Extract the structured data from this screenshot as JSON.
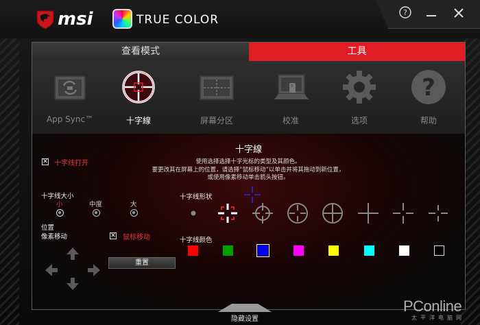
{
  "brand": {
    "logo_text": "msi",
    "product_text": "TRUE COLOR"
  },
  "window_controls": {
    "help_glyph": "?",
    "min_glyph": "—",
    "close_glyph": "✕"
  },
  "top_tabs": [
    {
      "label": "查看模式",
      "active": false
    },
    {
      "label": "工具",
      "active": true
    }
  ],
  "tools": [
    {
      "label": "App Sync™",
      "icon": "app-sync-icon",
      "active": false
    },
    {
      "label": "十字線",
      "icon": "crosshair-icon",
      "active": true
    },
    {
      "label": "屏幕分区",
      "icon": "screen-split-icon",
      "active": false
    },
    {
      "label": "校准",
      "icon": "calibration-icon",
      "active": false
    },
    {
      "label": "选项",
      "icon": "gear-icon",
      "active": false
    },
    {
      "label": "帮助",
      "icon": "help-icon",
      "active": false
    }
  ],
  "crosshair": {
    "title": "十字線",
    "description": [
      "使用选择选择十字光标的类型及其颜色。",
      "要更改其在屏幕上的位置，请选择“鼠标移动”以单击并将其拖动到新位置，",
      "或使用像素移动单击箭头按钮。"
    ],
    "enable_label": "十字线打开",
    "enable_checked": true,
    "size_label": "十字线大小",
    "sizes": [
      {
        "label": "小",
        "selected": true
      },
      {
        "label": "中度",
        "selected": false
      },
      {
        "label": "大",
        "selected": false
      }
    ],
    "position_label": "位置",
    "pixel_move_label": "像素移动",
    "mouse_move_label": "鼠标移动",
    "mouse_move_checked": true,
    "reset_label": "重置",
    "shape_label": "十字线形状",
    "shapes": [
      "dot",
      "bracket-cross",
      "scope-cross",
      "circle-cross",
      "circle-plus",
      "plus",
      "gap-plus",
      "gap-plus-small"
    ],
    "selected_shape": 1,
    "color_label": "十字线颜色",
    "colors": [
      "#ff0000",
      "#00a000",
      "#0000ff",
      "#ff00ff",
      "#ffff00",
      "#00ffff",
      "#ffffff",
      "#000000"
    ],
    "selected_color": 2
  },
  "footer": {
    "hide_label": "隐藏设置"
  },
  "watermark": {
    "text": "PConline",
    "sub": "太平洋电脑网"
  },
  "accent_color": "#e01c24"
}
